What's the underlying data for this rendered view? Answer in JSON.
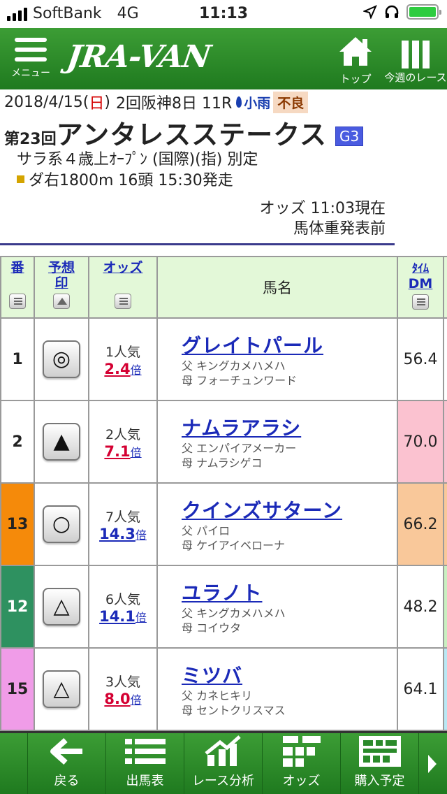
{
  "status_bar": {
    "carrier": "SoftBank",
    "network": "4G",
    "time": "11:13"
  },
  "header": {
    "menu_label": "メニュー",
    "logo": "JRA-VAN",
    "top_label": "トップ",
    "week_label": "今週のレース"
  },
  "race": {
    "date_pre": "2018/4/15(",
    "weekday": "日",
    "date_post": ")",
    "meeting": "2回阪神8日 11R",
    "weather": "小雨",
    "track_condition": "不良",
    "number": "第23回",
    "name": "アンタレスステークス",
    "grade": "G3",
    "class_line": "サラ系４歳上ｵｰﾌﾟﾝ (国際)(指) 別定",
    "distance_line": "ダ右1800m 16頭 15:30発走",
    "odds_time": "オッズ 11:03現在",
    "weight_status": "馬体重発表前",
    "colors": {
      "accent_green": "#2a8a2a",
      "link_blue": "#1b2ab8",
      "odds_red": "#d40032",
      "grade_blue": "#4a5be0"
    }
  },
  "table": {
    "headers": {
      "ban": "番",
      "mark1": "予想",
      "mark2": "印",
      "odds": "オッズ",
      "horse": "馬名",
      "time1": "ﾀｲﾑ",
      "time2": "DM"
    },
    "rows": [
      {
        "ban": "1",
        "mark": "◎",
        "pop": "1人気",
        "odds": "2.4",
        "bai": "倍",
        "horse": "グレイトパール",
        "sire": "父 キングカメハメハ",
        "dam": "母 フォーチュンワード",
        "dm": "56.4"
      },
      {
        "ban": "2",
        "mark": "▲",
        "pop": "2人気",
        "odds": "7.1",
        "bai": "倍",
        "horse": "ナムラアラシ",
        "sire": "父 エンパイアメーカー",
        "dam": "母 ナムラシゲコ",
        "dm": "70.0"
      },
      {
        "ban": "13",
        "mark": "○",
        "pop": "7人気",
        "odds": "14.3",
        "bai": "倍",
        "horse": "クインズサターン",
        "sire": "父 パイロ",
        "dam": "母 ケイアイベローナ",
        "dm": "66.2"
      },
      {
        "ban": "12",
        "mark": "△",
        "pop": "6人気",
        "odds": "14.1",
        "bai": "倍",
        "horse": "ユラノト",
        "sire": "父 キングカメハメハ",
        "dam": "母 コイウタ",
        "dm": "48.2"
      },
      {
        "ban": "15",
        "mark": "△",
        "pop": "3人気",
        "odds": "8.0",
        "bai": "倍",
        "horse": "ミツバ",
        "sire": "父 カネヒキリ",
        "dam": "母 セントクリスマス",
        "dm": "64.1"
      }
    ]
  },
  "toolbar": {
    "back": "戻る",
    "entries": "出馬表",
    "analysis": "レース分析",
    "odds": "オッズ",
    "purchase": "購入予定"
  }
}
